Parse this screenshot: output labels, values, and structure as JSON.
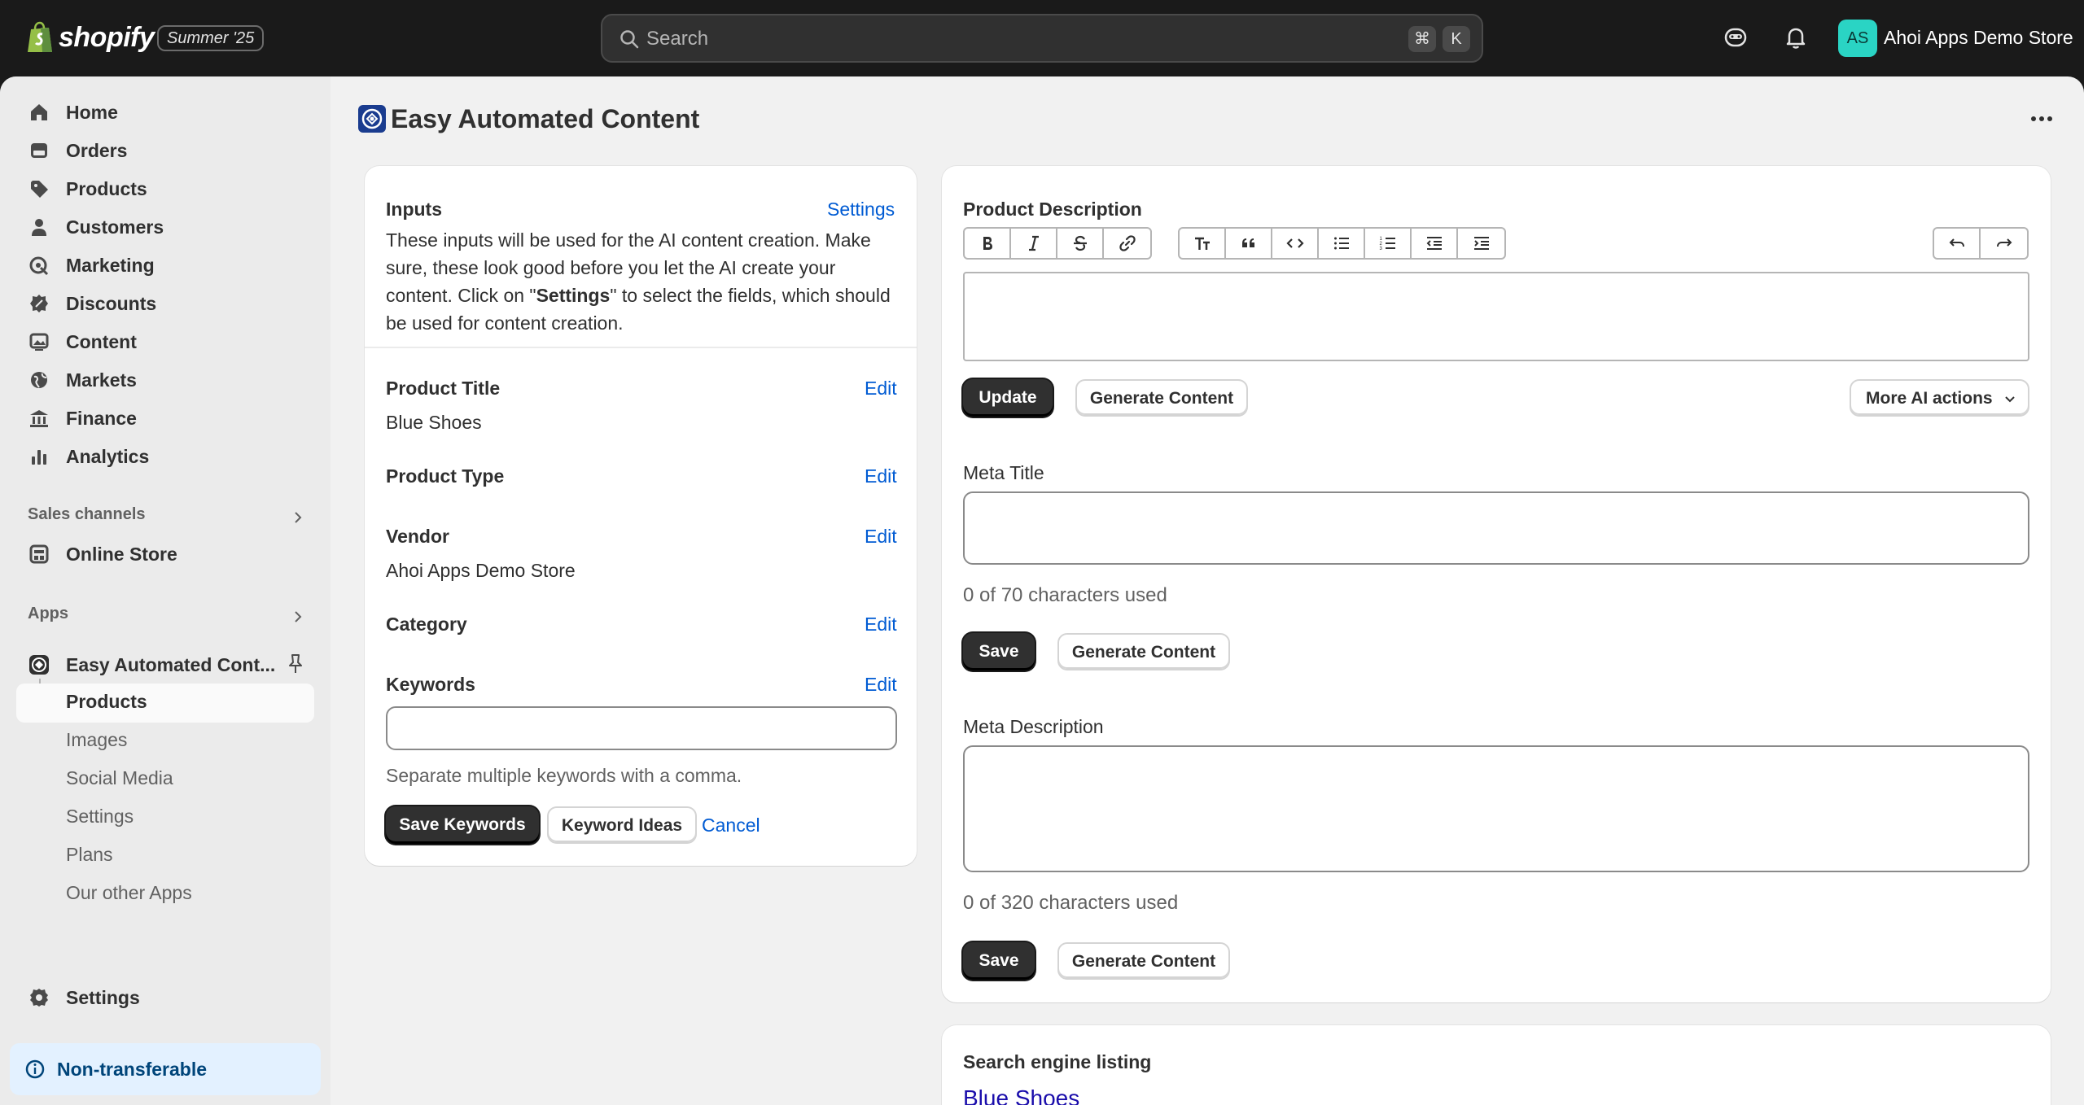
{
  "topbar": {
    "brand": "shopify",
    "edition": "Summer '25",
    "search_placeholder": "Search",
    "shortcut_cmd": "⌘",
    "shortcut_key": "K",
    "avatar_initials": "AS",
    "store_name": "Ahoi Apps Demo Store"
  },
  "sidebar": {
    "items": [
      {
        "label": "Home",
        "icon": "home-icon"
      },
      {
        "label": "Orders",
        "icon": "orders-icon"
      },
      {
        "label": "Products",
        "icon": "tag-icon"
      },
      {
        "label": "Customers",
        "icon": "person-icon"
      },
      {
        "label": "Marketing",
        "icon": "target-icon"
      },
      {
        "label": "Discounts",
        "icon": "discount-icon"
      },
      {
        "label": "Content",
        "icon": "image-icon"
      },
      {
        "label": "Markets",
        "icon": "globe-icon"
      },
      {
        "label": "Finance",
        "icon": "bank-icon"
      },
      {
        "label": "Analytics",
        "icon": "chart-icon"
      }
    ],
    "sales_channels_heading": "Sales channels",
    "online_store": "Online Store",
    "apps_heading": "Apps",
    "app_name": "Easy Automated Cont...",
    "app_subitems": [
      "Products",
      "Images",
      "Social Media",
      "Settings",
      "Plans",
      "Our other Apps"
    ],
    "settings": "Settings",
    "notice": "Non-transferable"
  },
  "page": {
    "title": "Easy Automated Content"
  },
  "inputs_card": {
    "heading": "Inputs",
    "settings_link": "Settings",
    "description_before": "These inputs will be used for the AI content creation. Make sure, these look good before you let the AI create your content. Click on \"",
    "description_bold": "Settings",
    "description_after": "\" to select the fields, which should be used for content creation.",
    "edit_label": "Edit",
    "product_title_label": "Product Title",
    "product_title_value": "Blue Shoes",
    "product_type_label": "Product Type",
    "vendor_label": "Vendor",
    "vendor_value": "Ahoi Apps Demo Store",
    "category_label": "Category",
    "keywords_label": "Keywords",
    "keywords_value": "",
    "keywords_help": "Separate multiple keywords with a comma.",
    "save_keywords": "Save Keywords",
    "keyword_ideas": "Keyword Ideas",
    "cancel": "Cancel"
  },
  "content_card": {
    "description_heading": "Product Description",
    "update": "Update",
    "generate_content": "Generate Content",
    "more_ai_actions": "More AI actions",
    "meta_title_label": "Meta Title",
    "meta_title_count": "0 of 70 characters used",
    "save": "Save",
    "meta_description_label": "Meta Description",
    "meta_description_count": "0 of 320 characters used"
  },
  "seo_card": {
    "heading": "Search engine listing",
    "link_title": "Blue Shoes"
  },
  "colors": {
    "topbar": "#1a1a1a",
    "link": "#005bd3",
    "primary_button": "#303030",
    "avatar": "#2ad4c4",
    "notice_bg": "#e3f1ff"
  }
}
